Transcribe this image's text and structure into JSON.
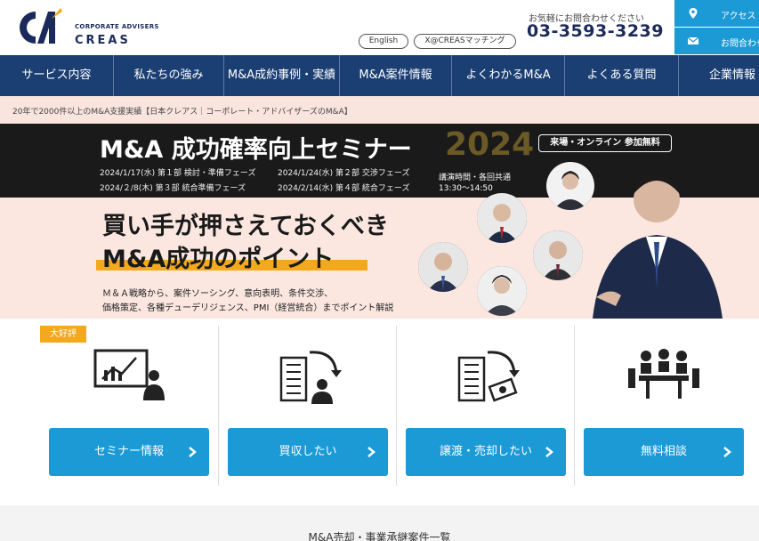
{
  "header": {
    "logo_subtitle": "CORPORATE ADVISERS",
    "logo_name": "CREAS",
    "english_label": "English",
    "x_label": "X@CREASマッチング",
    "contact_note": "お気軽にお問合わせください",
    "phone": "03-3593-3239",
    "access_label": "アクセス",
    "mail_label": "お問合わせ"
  },
  "nav": {
    "items": [
      {
        "label": "サービス内容"
      },
      {
        "label": "私たちの強み"
      },
      {
        "label": "M&A成約事例・実績"
      },
      {
        "label": "M&A案件情報"
      },
      {
        "label": "よくわかるM&A"
      },
      {
        "label": "よくある質問"
      },
      {
        "label": "企業情報"
      }
    ]
  },
  "breadcrumb": "20年で2000件以上のM&A支援実績【日本クレアス｜コーポレート・アドバイザーズのM&A】",
  "banner": {
    "title": "M&A 成功確率向上セミナー",
    "year": "2024",
    "badge": "来場・オンライン 参加無料",
    "schedule": [
      "2024/1/17(水) 第１部 検討・準備フェーズ",
      "2024/1/24(水) 第２部 交渉フェーズ",
      "2024/２/8(木) 第３部 統合準備フェーズ",
      "2024/2/14(水) 第４部 統合フェーズ"
    ],
    "time_label": "講演時間・各回共通",
    "time_value": "13:30〜14:50",
    "headline1": "買い手が押さえておくべき",
    "headline2": "M&A成功のポイント",
    "desc1": "Ｍ＆Ａ戦略から、案件ソーシング、意向表明、条件交渉、",
    "desc2": "価格策定、各種デューデリジェンス、PMI（経営統合）までポイント解説"
  },
  "cards": {
    "hot_badge": "大好評",
    "items": [
      {
        "label": "セミナー情報",
        "icon": "presentation-icon"
      },
      {
        "label": "買収したい",
        "icon": "acquire-icon"
      },
      {
        "label": "譲渡・売却したい",
        "icon": "sell-icon"
      },
      {
        "label": "無料相談",
        "icon": "consultation-icon"
      }
    ]
  },
  "list_section": {
    "title": "M&A売却・事業承継案件一覧"
  },
  "colors": {
    "navy": "#1b3f73",
    "accent_blue": "#1b9ad6",
    "orange": "#f4a81d"
  }
}
